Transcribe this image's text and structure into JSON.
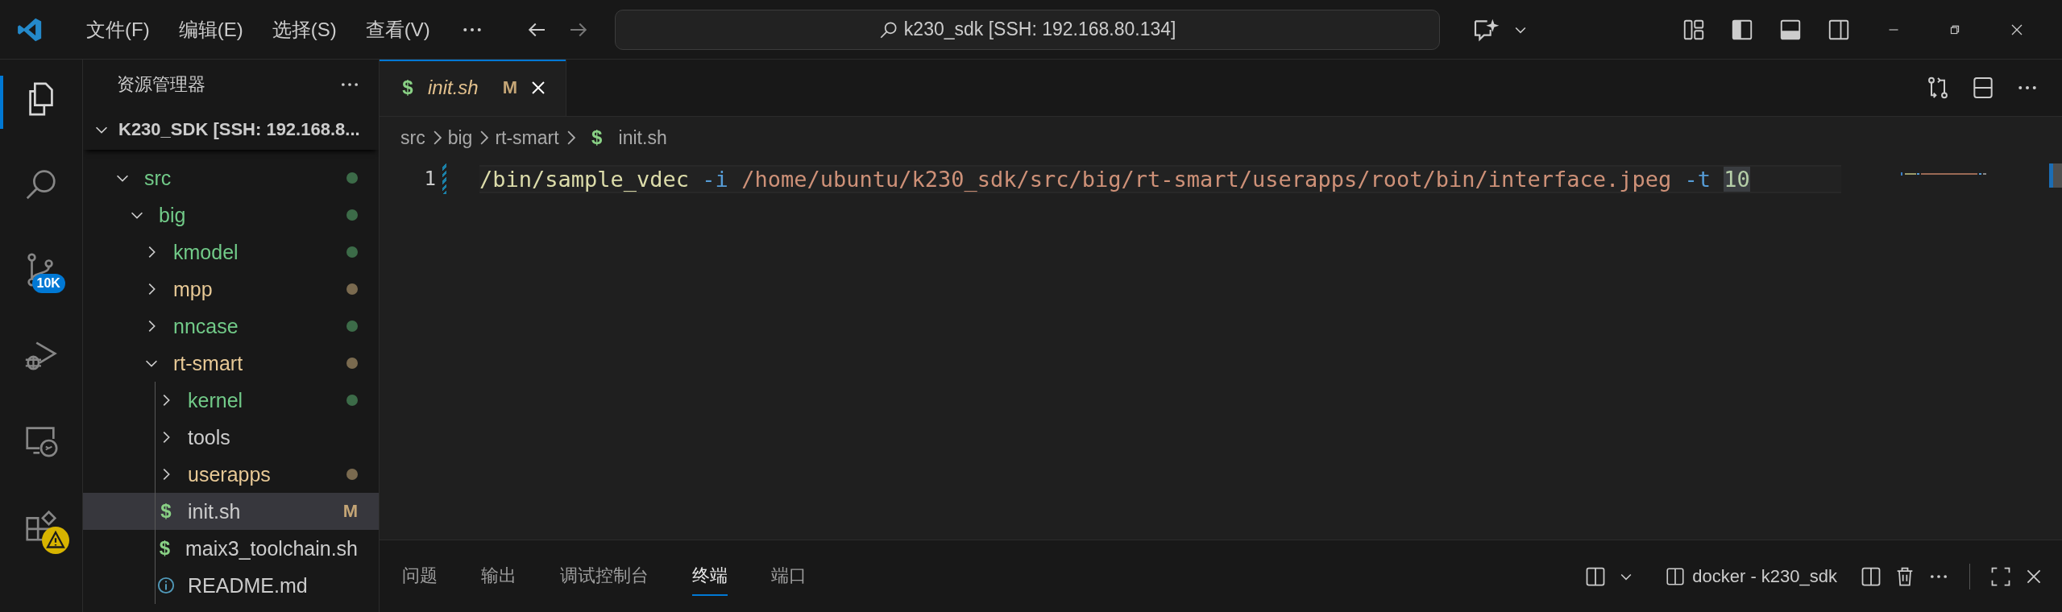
{
  "title_bar": {
    "menus": [
      {
        "label": "文件(F)"
      },
      {
        "label": "编辑(E)"
      },
      {
        "label": "选择(S)"
      },
      {
        "label": "查看(V)"
      }
    ],
    "command_center": {
      "text": "k230_sdk [SSH: 192.168.80.134]"
    }
  },
  "activity_bar": {
    "items": [
      {
        "kind": "explorer",
        "selected": true,
        "warning": false
      },
      {
        "kind": "search",
        "selected": false,
        "warning": false
      },
      {
        "kind": "source_control",
        "selected": false,
        "badge": "10K",
        "warning": false
      },
      {
        "kind": "run_debug",
        "selected": false,
        "warning": false
      },
      {
        "kind": "remote",
        "selected": false,
        "warning": false
      },
      {
        "kind": "extensions",
        "selected": false,
        "warning": true
      }
    ]
  },
  "sidebar": {
    "title": "资源管理器",
    "root": {
      "label": "K230_SDK [SSH: 192.168.8...",
      "expanded": true
    },
    "tree": [
      {
        "label": "src",
        "kind": "folder",
        "expanded": true,
        "color": "#3c6b48",
        "selected": false,
        "children": [
          {
            "label": "big",
            "kind": "folder",
            "expanded": true,
            "color": "#3c6b48",
            "selected": false,
            "children": [
              {
                "label": "kmodel",
                "kind": "folder",
                "expanded": false,
                "color": "#3c6b48",
                "selected": false
              },
              {
                "label": "mpp",
                "kind": "folder",
                "expanded": false,
                "color": "#7a6a4f",
                "selected": false
              },
              {
                "label": "nncase",
                "kind": "folder",
                "expanded": false,
                "color": "#3c6b48",
                "selected": false
              },
              {
                "label": "rt-smart",
                "kind": "folder",
                "expanded": true,
                "color": "#7a6a4f",
                "selected": false,
                "children": [
                  {
                    "label": "kernel",
                    "kind": "folder",
                    "expanded": false,
                    "color": "#3c6b48",
                    "selected": false
                  },
                  {
                    "label": "tools",
                    "kind": "folder",
                    "expanded": false,
                    "selected": false
                  },
                  {
                    "label": "userapps",
                    "kind": "folder",
                    "expanded": false,
                    "color": "#7a6a4f",
                    "selected": false
                  },
                  {
                    "label": "init.sh",
                    "kind": "shell",
                    "icon": "$",
                    "badge": "M",
                    "selected": true
                  },
                  {
                    "label": "maix3_toolchain.sh",
                    "kind": "shell",
                    "icon": "$",
                    "selected": false
                  },
                  {
                    "label": "README.md",
                    "kind": "info",
                    "selected": false
                  }
                ]
              }
            ]
          }
        ]
      }
    ]
  },
  "editor": {
    "tabs": [
      {
        "label": "init.sh",
        "kind": "shell",
        "icon": "$",
        "badge": "M",
        "preview": true,
        "selected": true
      }
    ],
    "breadcrumbs": [
      {
        "label": "src",
        "kind": "folder"
      },
      {
        "label": "big",
        "kind": "folder"
      },
      {
        "label": "rt-smart",
        "kind": "folder"
      },
      {
        "label": "init.sh",
        "kind": "shell",
        "icon": "$"
      }
    ],
    "lines": [
      {
        "number": "1",
        "modified": true,
        "tokens": [
          {
            "text": "/bin/sample_vdec",
            "kind": "command"
          },
          {
            "text": "-i",
            "kind": "flag"
          },
          {
            "text": "/home/ubuntu/k230_sdk/src/big/rt-smart/userapps/root/bin/interface.jpeg",
            "kind": "string"
          },
          {
            "text": "-t",
            "kind": "flag"
          },
          {
            "text": "10",
            "kind": "number",
            "highlighted": true
          }
        ]
      }
    ]
  },
  "panel": {
    "tabs": [
      {
        "label": "问题",
        "selected": false
      },
      {
        "label": "输出",
        "selected": false
      },
      {
        "label": "调试控制台",
        "selected": false
      },
      {
        "label": "终端",
        "selected": true
      },
      {
        "label": "端口",
        "selected": false
      }
    ],
    "terminal": {
      "label": "docker - k230_sdk"
    }
  }
}
